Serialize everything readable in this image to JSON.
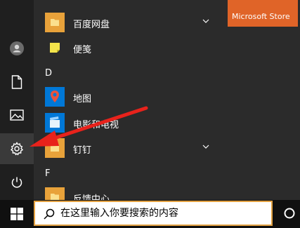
{
  "rail": {
    "items": [
      {
        "name": "user",
        "icon": "user-avatar-icon"
      },
      {
        "name": "documents",
        "icon": "document-icon"
      },
      {
        "name": "pictures",
        "icon": "picture-icon"
      },
      {
        "name": "settings",
        "icon": "gear-icon"
      },
      {
        "name": "power",
        "icon": "power-icon"
      }
    ]
  },
  "apps": {
    "baidu": {
      "label": "百度网盘",
      "color": "#e8a23a"
    },
    "sticky": {
      "label": "便笺",
      "color": "#f4e44b"
    },
    "section_d": "D",
    "maps": {
      "label": "地图",
      "color": "#0078d7"
    },
    "movies": {
      "label": "电影和电视",
      "color": "#0078d7"
    },
    "dingding": {
      "label": "钉钉",
      "color": "#e8a23a"
    },
    "section_f": "F",
    "feedback": {
      "label": "反馈中心",
      "color": "#e8a23a"
    }
  },
  "tiles": {
    "ms_store": {
      "label": "Microsoft Store",
      "color": "#e06428"
    }
  },
  "taskbar": {
    "search_placeholder": "在这里输入你要搜索的内容"
  },
  "annotation": {
    "arrow_color": "#e8221b"
  }
}
